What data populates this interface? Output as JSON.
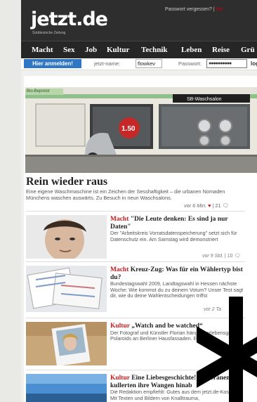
{
  "header": {
    "logo": "jetzt.de",
    "logo_sub": "Süddeutsche Zeitung",
    "top_link": "Passwort vergessen?",
    "top_sep": "|",
    "top_red": "live"
  },
  "nav": {
    "items": [
      "Macht",
      "Sex",
      "Job",
      "Kultur",
      "Technik",
      "Leben",
      "Reise",
      "Grü"
    ]
  },
  "login": {
    "button": "Hier anmelden!",
    "nick_label": "jetzt-name:",
    "nick_value": "flowkev",
    "pw_label": "Passwort:",
    "pw_value": "●●●●●●●●●●",
    "login_link": "login"
  },
  "hero": {
    "tag": "Bio-Bepreist",
    "shop_sign": "SB-Waschsalon",
    "price": "1.50",
    "title": "Rein wieder raus",
    "desc": "Eine eigene Waschmaschine ist ein Zeichen der Sesshaftigkeit – die urbanen Nomaden Münchens waschen auswärts. Zu Besuch in neun Waschsalons.",
    "time": "vor 6 Min.",
    "sep": "|",
    "comments": "21"
  },
  "articles": [
    {
      "category": "Macht",
      "title": "\"Die Leute denken: Es sind ja nur Daten\"",
      "desc": "Der \"Arbeitskreis Vorratsdatenspeicherung\" setzt sich für Datenschutz ein. Am Samstag wird demonstriert",
      "time": "vor 9 Std.",
      "sep": "|",
      "comments": "10"
    },
    {
      "category": "Macht",
      "title": "Kreuz-Zug: Was für ein Wählertyp bist du?",
      "desc": "Bundestagswahl 2009, Landtagswahl in Hessen nächste Woche: Wie kommst du zu deinem Votum? Unser Test sagt dir, wie du deine Wahlentscheidungen triffst",
      "time": "vor 2 Ta",
      "sep": "",
      "comments": ""
    },
    {
      "category": "Kultur",
      "title": "„Watch and be watched“",
      "desc": "Der Fotograf und Künstler Florian hängt überlebensgroße Polaroids an Berliner Hausfassaden. Ein Interv",
      "time": "",
      "sep": "",
      "comments": ""
    },
    {
      "category": "Kultur",
      "title": "Eine Liebesgeschichte! Ein Tränen kullerten ihre Wangen hinab",
      "desc": "Die Redaktion empfiehlt: Gutes aus dem jetzt.de-Kosmos. Mit Texten und Bildern von Knalltrauma,",
      "time": "",
      "sep": "",
      "comments": ""
    }
  ],
  "colors": {
    "header_bg": "#2e2e2e",
    "login_button": "#2f76c4",
    "category_red": "#c21d1d"
  }
}
